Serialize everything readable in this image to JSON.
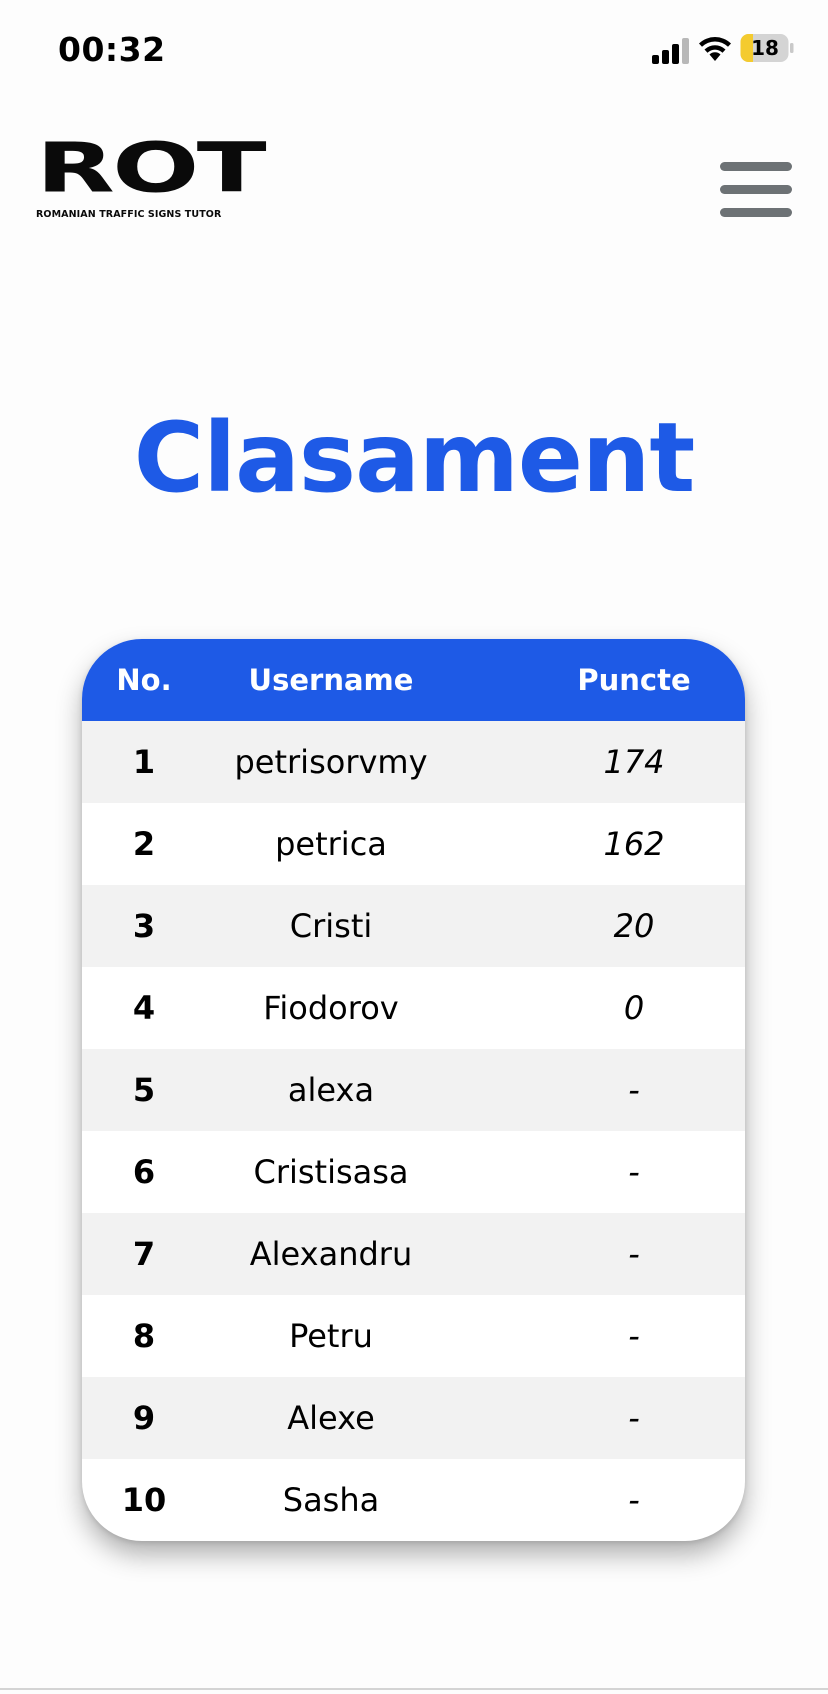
{
  "status_bar": {
    "time": "00:32",
    "battery": "18",
    "icons": [
      "signal-icon",
      "wifi-icon",
      "battery-icon"
    ]
  },
  "header": {
    "logo_text": "ROT",
    "logo_tagline": "ROMANIAN TRAFFIC SIGNS TUTOR",
    "menu_icon": "hamburger-menu-icon"
  },
  "page": {
    "title": "Clasament"
  },
  "leaderboard": {
    "columns": [
      "No.",
      "Username",
      "Puncte"
    ],
    "rows": [
      {
        "no": "1",
        "username": "petrisorvmy",
        "points": "174"
      },
      {
        "no": "2",
        "username": "petrica",
        "points": "162"
      },
      {
        "no": "3",
        "username": "Cristi",
        "points": "20"
      },
      {
        "no": "4",
        "username": "Fiodorov",
        "points": "0"
      },
      {
        "no": "5",
        "username": "alexa",
        "points": "-"
      },
      {
        "no": "6",
        "username": "Cristisasa",
        "points": "-"
      },
      {
        "no": "7",
        "username": "Alexandru",
        "points": "-"
      },
      {
        "no": "8",
        "username": "Petru",
        "points": "-"
      },
      {
        "no": "9",
        "username": "Alexe",
        "points": "-"
      },
      {
        "no": "10",
        "username": "Sasha",
        "points": "-"
      }
    ]
  },
  "colors": {
    "accent": "#1e5ae6",
    "row_alt": "#f2f2f2",
    "menu_bars": "#6d7275"
  }
}
